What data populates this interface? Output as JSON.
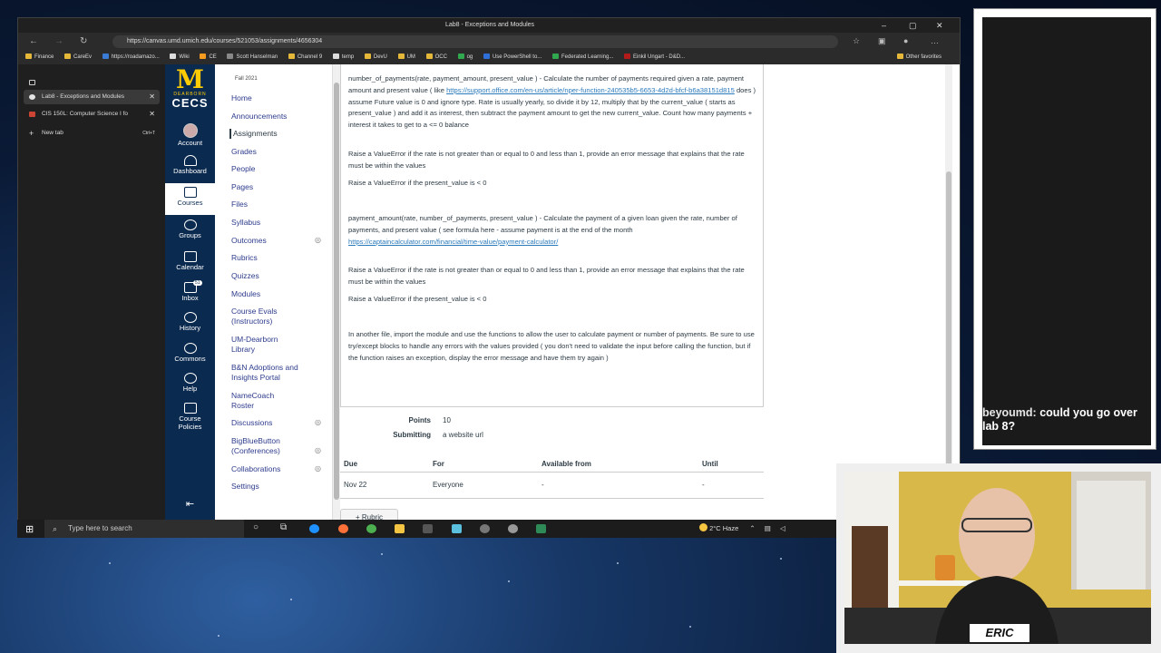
{
  "browser": {
    "window_title": "Lab8 - Exceptions and Modules",
    "url": "https://canvas.umd.umich.edu/courses/521053/assignments/4656304",
    "favorites": [
      "Finance",
      "CareEv",
      "https://roadamazo...",
      "Wiki",
      "CE",
      "Scott Hanselman",
      "Channel 9",
      "temp",
      "DevU",
      "UM",
      "OCC",
      "og",
      "Use PowerShell to...",
      "Federated Learning...",
      "Einkil Ungart - D&D..."
    ],
    "other_favorites": "Other favorites"
  },
  "tabs": [
    {
      "label": "Lab8 - Exceptions and Modules",
      "active": true
    },
    {
      "label": "CIS 150L: Computer Science I fo"
    },
    {
      "label": "New tab",
      "shortcut": "Ctrl+T"
    }
  ],
  "global_nav": {
    "logo_m": "M",
    "logo_sub": "DEARBORN",
    "logo_cecs": "CECS",
    "items": [
      "Account",
      "Dashboard",
      "Courses",
      "Groups",
      "Calendar",
      "Inbox",
      "History",
      "Commons",
      "Help",
      "Course Policies"
    ],
    "inbox_badge": "51"
  },
  "course_nav": {
    "term": "Fall 2021",
    "items": [
      "Home",
      "Announcements",
      "Assignments",
      "Grades",
      "People",
      "Pages",
      "Files",
      "Syllabus",
      "Outcomes",
      "Rubrics",
      "Quizzes",
      "Modules",
      "Course Evals (Instructors)",
      "UM-Dearborn Library",
      "B&N Adoptions and Insights Portal",
      "NameCoach Roster",
      "Discussions",
      "BigBlueButton (Conferences)",
      "Collaborations",
      "Settings"
    ]
  },
  "assignment": {
    "p1_text": "number_of_payments(rate, payment_amount, present_value ) - Calculate the number of payments required given a rate, payment amount and present value ( like ",
    "p1_link": "https://support.office.com/en-us/article/nper-function-240535b5-6653-4d2d-bfcf-b6a38151d815",
    "p1_text2": " does ) assume Future value is 0 and ignore type.  Rate is usually yearly, so divide it by 12, multiply that by the current_value ( starts as present_value ) and add it as interest, then subtract the payment amount to get the new current_value.  Count how many payments + interest it takes to get to a <= 0 balance",
    "p2": "Raise a ValueError if the rate is not greater than or equal to 0 and less than 1, provide an error message that explains that the rate must be within the values",
    "p3": "Raise a ValueError if the present_value is < 0",
    "p4_text": "payment_amount(rate, number_of_payments, present_value ) - Calculate the payment of a given loan given the rate, number of payments, and present value ( see formula here - assume payment is at the end of the month ",
    "p4_link": "https://captaincalculator.com/financial/time-value/payment-calculator/",
    "p5": "Raise a ValueError if the rate is not greater than or equal to 0 and less than 1, provide an error message that explains that the rate must be within the values",
    "p6": "Raise a ValueError if the present_value is < 0",
    "p7": "In another file, import the module and use the functions to allow the user to calculate payment or number of payments.  Be sure to use try/except blocks to handle any errors with the values provided ( you don't need to validate the input before calling the function, but if the function raises an exception, display the error message and have them try again )"
  },
  "meta": {
    "points_label": "Points",
    "points_value": "10",
    "submitting_label": "Submitting",
    "submitting_value": "a website url"
  },
  "due_table": {
    "headers": [
      "Due",
      "For",
      "Available from",
      "Until"
    ],
    "row": [
      "Nov 22",
      "Everyone",
      "-",
      "-"
    ]
  },
  "rubric_button": "+ Rubric",
  "taskbar": {
    "search_placeholder": "Type here to search",
    "weather": "2°C Haze"
  },
  "chat": {
    "user": "beyoumd:",
    "message": "could you go over lab 8?"
  },
  "webcam": {
    "name": "ERIC"
  }
}
